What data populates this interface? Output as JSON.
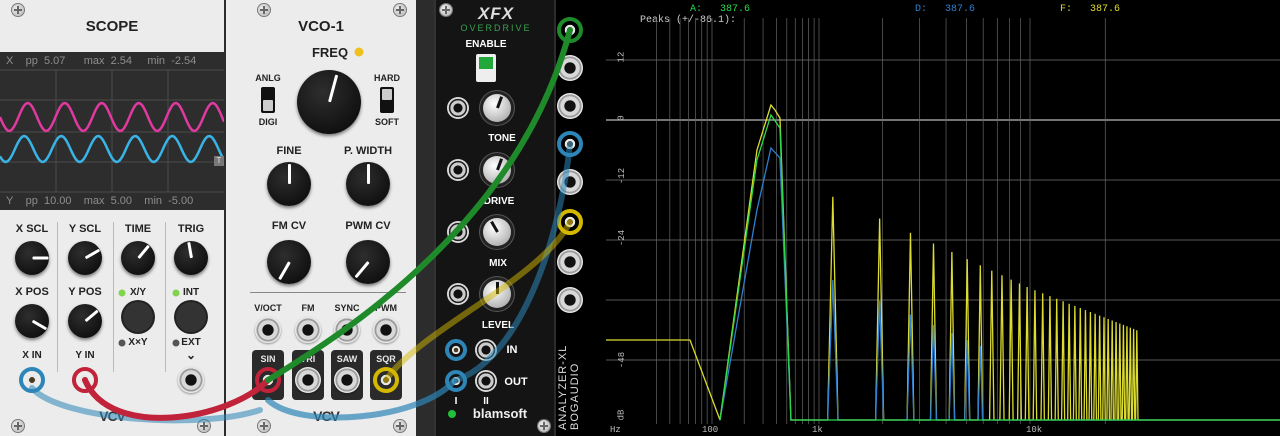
{
  "scope": {
    "title": "SCOPE",
    "x_stats": {
      "ch": "X",
      "pp_label": "pp",
      "pp": "5.07",
      "max_label": "max",
      "max": "2.54",
      "min_label": "min",
      "min": "-2.54"
    },
    "y_stats": {
      "ch": "Y",
      "pp_label": "pp",
      "pp": "10.00",
      "max_label": "max",
      "max": "5.00",
      "min_label": "min",
      "min": "-5.00"
    },
    "trig_marker": "T",
    "controls": {
      "x_scl": "X SCL",
      "y_scl": "Y SCL",
      "time": "TIME",
      "trig": "TRIG",
      "x_pos": "X POS",
      "y_pos": "Y POS",
      "xy": "X/Y",
      "xxy": "X×Y",
      "int": "INT",
      "ext": "EXT",
      "x_in": "X IN",
      "y_in": "Y IN"
    },
    "logo": "VCV",
    "colors": {
      "x_trace": "#e0399f",
      "y_trace": "#3ab4e6"
    }
  },
  "vco": {
    "title": "VCO-1",
    "freq": "FREQ",
    "anlg": "ANLG",
    "digi": "DIGI",
    "hard": "HARD",
    "soft": "SOFT",
    "fine": "FINE",
    "pwidth": "P. WIDTH",
    "fmcv": "FM CV",
    "pwmcv": "PWM CV",
    "inputs": [
      "V/OCT",
      "FM",
      "SYNC",
      "PWM"
    ],
    "outputs": [
      "SIN",
      "TRI",
      "SAW",
      "SQR"
    ],
    "logo": "VCV"
  },
  "xfx": {
    "logo": "XFX",
    "subtitle": "OVERDRIVE",
    "enable": "ENABLE",
    "tone": "TONE",
    "drive": "DRIVE",
    "mix": "MIX",
    "level": "LEVEL",
    "in": "IN",
    "out": "OUT",
    "ch1": "I",
    "ch2": "II",
    "brand": "blamsoft"
  },
  "analyzer": {
    "name_line1": "ANALYZER-XL",
    "name_line2": "BOGAUDIO",
    "peaks_label": "Peaks (+/-86.1):",
    "peak_a_label": "A:",
    "peak_a": "387.6",
    "peak_d_label": "D:",
    "peak_d": "387.6",
    "peak_f_label": "F:",
    "peak_f": "387.6",
    "y_ticks": [
      "12",
      "0",
      "-12",
      "-24",
      "-48",
      "dB"
    ],
    "x_ticks": [
      "Hz",
      "100",
      "1k",
      "10k"
    ],
    "colors": {
      "A": "#2bd94a",
      "D": "#2f7fd0",
      "F": "#dcdc30"
    }
  },
  "cables": {
    "colors": {
      "green": "#1f8a2a",
      "red": "#c0233a",
      "blue": "#2e86b8",
      "yellow": "#d4b800"
    }
  }
}
